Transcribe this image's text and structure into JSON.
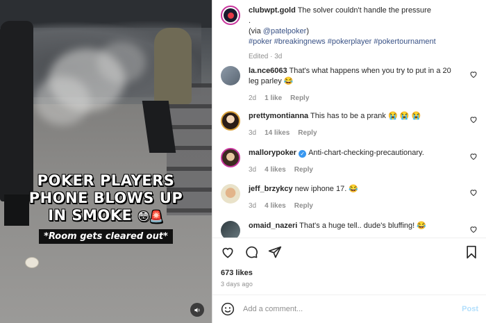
{
  "video": {
    "caption_lines": [
      "POKER PLAYERS",
      "PHONE BLOWS UP",
      "IN SMOKE"
    ],
    "caption_emoji": "😳🚨",
    "sub_caption": "*Room gets cleared out*",
    "sound_icon": "speaker-icon"
  },
  "post": {
    "author": "clubwpt.gold",
    "caption_text": "The solver couldn't handle the pressure",
    "caption_dot": ".",
    "via_prefix": "(via ",
    "via_handle": "@patelpoker",
    "via_suffix": ")",
    "hashtags": "#poker #breakingnews #pokerplayer #pokertournament",
    "edited": "Edited · 3d"
  },
  "comments": [
    {
      "user": "la.nce6063",
      "text": "That's what happens when you try to put in a 20 leg parley 😂",
      "age": "2d",
      "likes": "1 like",
      "reply": "Reply",
      "verified": false
    },
    {
      "user": "prettymontianna",
      "text": "This has to be a prank 😭 😭 😭",
      "age": "3d",
      "likes": "14 likes",
      "reply": "Reply",
      "verified": false
    },
    {
      "user": "mallorypoker",
      "text": "Anti-chart-checking-precautionary.",
      "age": "3d",
      "likes": "4 likes",
      "reply": "Reply",
      "verified": true
    },
    {
      "user": "jeff_brzykcy",
      "text": "new iphone 17. 😂",
      "age": "3d",
      "likes": "4 likes",
      "reply": "Reply",
      "verified": false
    },
    {
      "user": "omaid_nazeri",
      "text": "That's a huge tell.. dude's bluffing! 😂",
      "age": "",
      "likes": "",
      "reply": "",
      "verified": false
    }
  ],
  "actions": {
    "likes": "673 likes",
    "time_ago": "3 days ago"
  },
  "add_comment": {
    "placeholder": "Add a comment...",
    "post_label": "Post"
  },
  "colors": {
    "link": "#385185",
    "post_disabled": "#b2dffc",
    "verified": "#3897f0"
  }
}
